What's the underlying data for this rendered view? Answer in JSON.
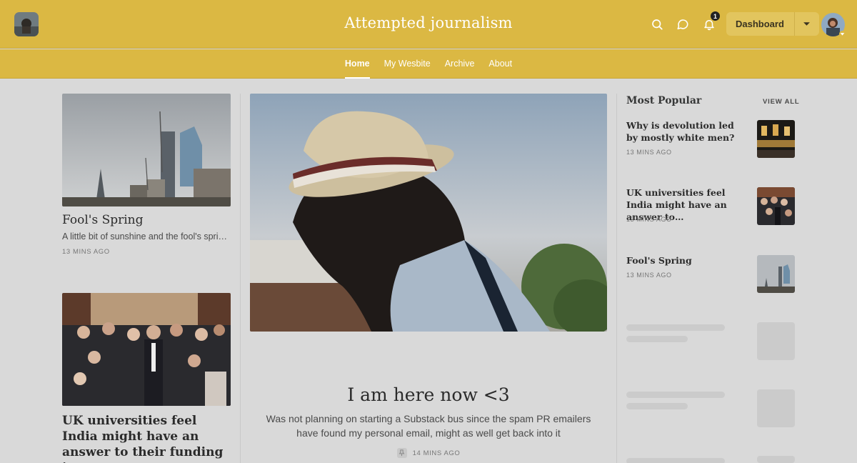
{
  "header": {
    "title": "Attempted journalism",
    "notifications_count": "1",
    "dashboard_label": "Dashboard"
  },
  "nav": {
    "items": [
      {
        "label": "Home",
        "active": true
      },
      {
        "label": "My Wesbite",
        "active": false
      },
      {
        "label": "Archive",
        "active": false
      },
      {
        "label": "About",
        "active": false
      }
    ]
  },
  "left_posts": [
    {
      "title": "Fool's Spring",
      "subtitle": "A little bit of sunshine and the fool's spring of the week",
      "meta": "13 MINS AGO"
    },
    {
      "title": "UK universities feel India might have an answer to their funding issues",
      "meta": ""
    }
  ],
  "featured": {
    "title": "I am here now <3",
    "subtitle": "Was not planning on starting a Substack bus since the spam PR emailers have found my personal email, might as well get back into it",
    "meta": "14 MINS AGO"
  },
  "popular": {
    "heading": "Most Popular",
    "view_all": "VIEW ALL",
    "items": [
      {
        "title": "Why is devolution led by mostly white men?",
        "meta": "13 MINS AGO"
      },
      {
        "title": "UK universities feel India might have an answer to…",
        "meta": "13 MINS AGO"
      },
      {
        "title": "Fool's Spring",
        "meta": "13 MINS AGO"
      }
    ]
  },
  "colors": {
    "accent": "#dbb843",
    "background": "#d9d9d9"
  }
}
